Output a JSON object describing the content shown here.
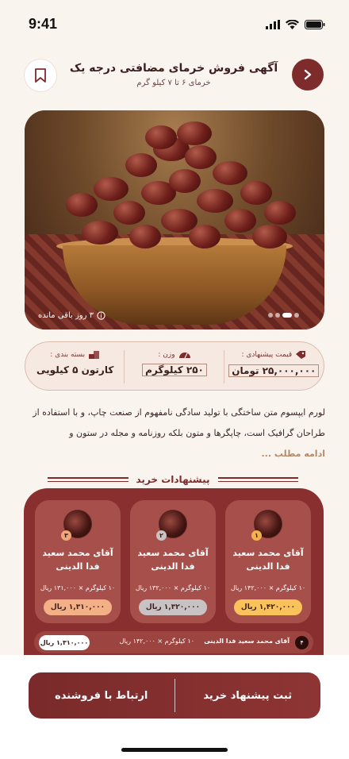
{
  "status": {
    "time": "9:41"
  },
  "header": {
    "title": "آگهی فروش خرمای مضافتی درجه یک",
    "subtitle": "خرمای ۶ تا ۷ کیلو گرم"
  },
  "hero": {
    "remaining_text": "۳ روز باقی مانده",
    "slides": 4,
    "active_slide": 1
  },
  "info": {
    "price_label": "قیمت پیشنهادی :",
    "price_value": "۲۵,۰۰۰,۰۰۰ تومان",
    "weight_label": "وزن :",
    "weight_value": "۲۵۰ کیلوگرم",
    "pack_label": "بسته بندی :",
    "pack_value": "کارتون ۵ کیلویی"
  },
  "description": {
    "text": "لورم ایپسوم متن ساختگی با تولید سادگی نامفهوم از صنعت چاپ، و با استفاده از طراحان گرافیک است، چاپگرها و متون بلکه روزنامه و مجله در ستون و",
    "read_more": "ادامه مطلب ..."
  },
  "offers": {
    "section_title": "پیشنهادات خرید",
    "cards": [
      {
        "rank": "۱",
        "name": "آقای محمد سعید فدا الدینی",
        "calc": "۱۰ کیلوگرم × ۱۴۲,۰۰۰ ریال",
        "total": "۱,۴۲۰,۰۰۰ ریال",
        "rank_color": "#f2b34c",
        "total_color": "#f9c25a"
      },
      {
        "rank": "۲",
        "name": "آقای محمد سعید فدا الدینی",
        "calc": "۱۰ کیلوگرم × ۱۳۲,۰۰۰ ریال",
        "total": "۱,۳۲۰,۰۰۰ ریال",
        "rank_color": "#c9c3c3",
        "total_color": "#c8c2c4"
      },
      {
        "rank": "۳",
        "name": "آقای محمد سعید فدا الدینی",
        "calc": "۱۰ کیلوگرم × ۱۳۱,۰۰۰ ریال",
        "total": "۱,۳۱۰,۰۰۰ ریال",
        "rank_color": "#f0a878",
        "total_color": "#f3b086"
      }
    ],
    "row": {
      "rank": "۴",
      "name": "آقای محمد سعید فدا الدینی",
      "calc": "۱۰ کیلوگرم × ۱۴۲,۰۰۰ ریال",
      "total": "۱,۳۱۰,۰۰۰ ریال"
    }
  },
  "actions": {
    "submit_offer": "ثبت پیشنهاد خرید",
    "contact_seller": "ارتباط با فروشنده"
  },
  "colors": {
    "primary": "#7d2b2b",
    "panel": "#8a2f2f",
    "background": "#faf4ef"
  }
}
